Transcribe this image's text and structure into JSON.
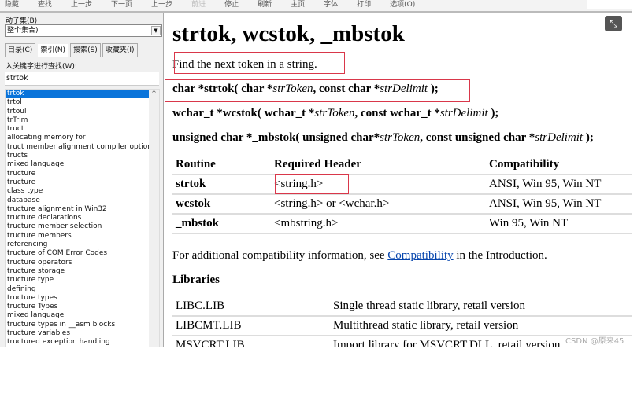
{
  "toolbar": {
    "items": [
      "隐藏",
      "查找",
      "上一步",
      "下一页",
      "上一步",
      "前进",
      "停止",
      "刷新",
      "主页",
      "字体",
      "打印",
      "选项(O)"
    ]
  },
  "left": {
    "subset_label": "动子集(B)",
    "subset_value": "整个集合)",
    "tabs": [
      "目录(C)",
      "索引(N)",
      "搜索(S)",
      "收藏夹(I)"
    ],
    "active_tab": 1,
    "keyword_label": "入关键字进行查找(W):",
    "search_value": "strtok",
    "items": [
      "trtok",
      "trtol",
      "trtoul",
      "trTrim",
      "truct",
      " allocating memory for",
      "truct member alignment compiler option",
      "tructs",
      " mixed language",
      "tructure",
      " tructure",
      " class type",
      " database",
      "tructure alignment in Win32",
      "tructure declarations",
      "tructure member selection",
      "tructure members",
      " referencing",
      "tructure of COM Error Codes",
      "tructure operators",
      "tructure storage",
      "tructure type",
      " defining",
      "tructure types",
      " tructure Types",
      " mixed language",
      "tructure types in __asm blocks",
      "tructure variables",
      "tructured exception handling"
    ]
  },
  "page": {
    "title": "strtok, wcstok, _mbstok",
    "summary": "Find the next token in a string.",
    "sig1": {
      "a": "char *strtok( char *",
      "b": "strToken",
      "c": ", const char *",
      "d": "strDelimit",
      "e": " );"
    },
    "sig2": {
      "a": "wchar_t *wcstok( wchar_t *",
      "b": "strToken",
      "c": ", const wchar_t *",
      "d": "strDelimit",
      "e": " );"
    },
    "sig3": {
      "a": "unsigned char *_mbstok( unsigned char*",
      "b": "strToken",
      "c": ", const unsigned char *",
      "d": "strDelimit",
      "e": " );"
    },
    "table_headers": [
      "Routine",
      "Required Header",
      "Compatibility"
    ],
    "table_rows": [
      [
        "strtok",
        "<string.h>",
        "ANSI, Win 95, Win NT"
      ],
      [
        "wcstok",
        "<string.h> or <wchar.h>",
        "ANSI, Win 95, Win NT"
      ],
      [
        "_mbstok",
        "<mbstring.h>",
        "Win 95, Win NT"
      ]
    ],
    "compat_pre": "For additional compatibility information, see ",
    "compat_link": "Compatibility",
    "compat_post": " in the Introduction.",
    "libraries_heading": "Libraries",
    "libs": [
      [
        "LIBC.LIB",
        "Single thread static library, retail version"
      ],
      [
        "LIBCMT.LIB",
        "Multithread static library, retail version"
      ],
      [
        "MSVCRT.LIB",
        "Import library for MSVCRT.DLL, retail version"
      ]
    ]
  },
  "watermark": "CSDN @原来45",
  "highlight_color": "#d9374a"
}
